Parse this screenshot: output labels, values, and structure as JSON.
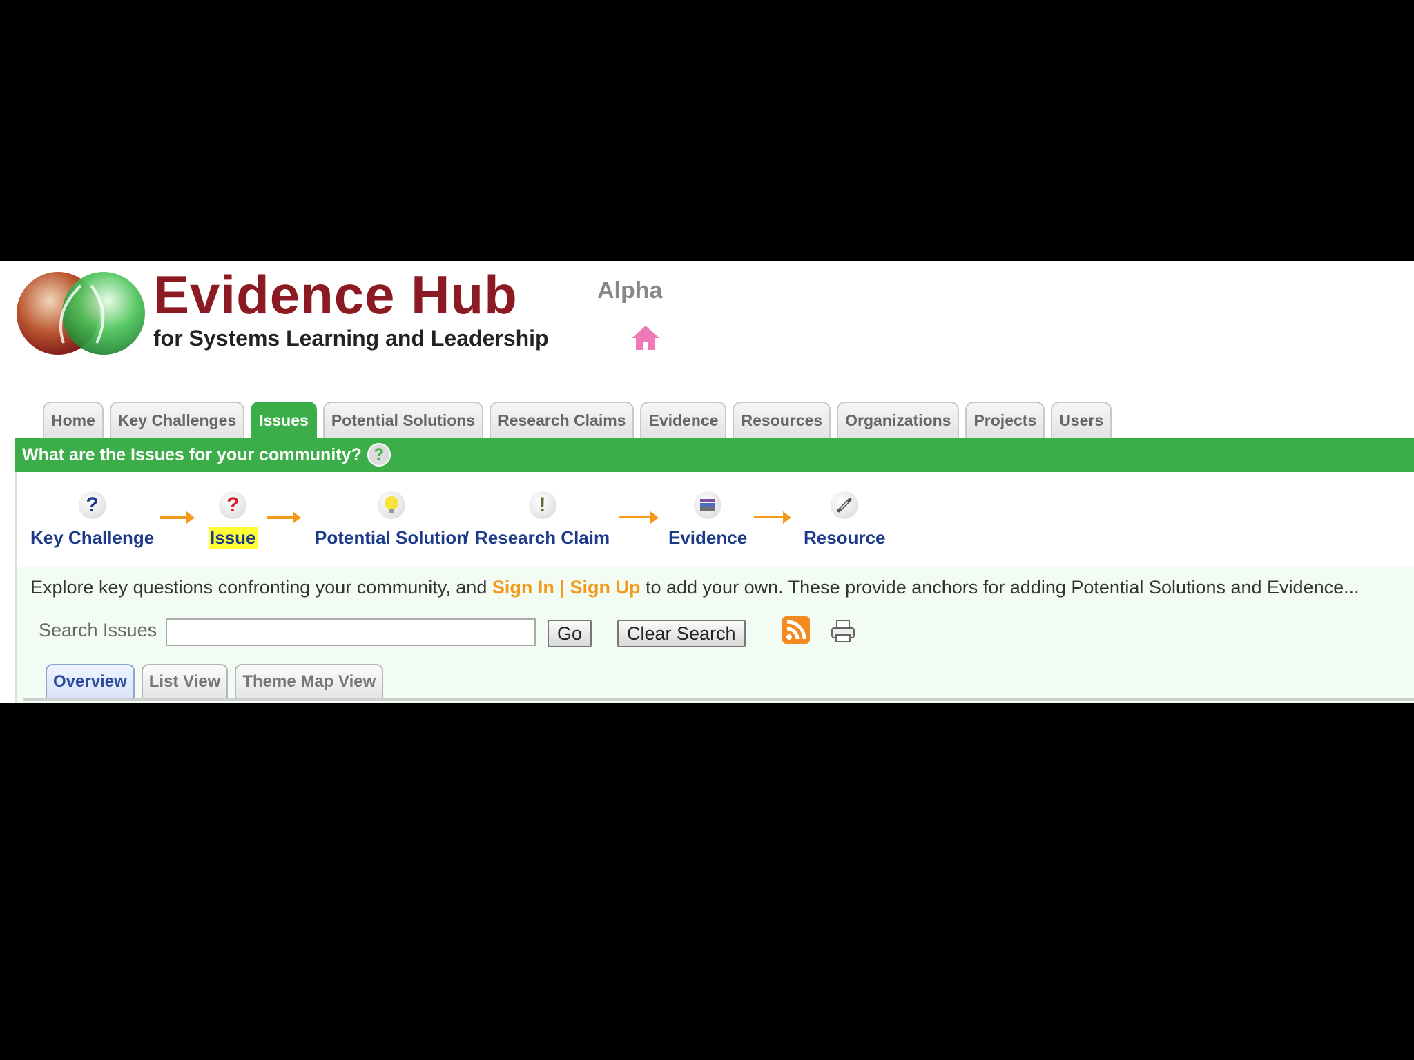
{
  "header": {
    "brand_title": "Evidence Hub",
    "brand_subtitle": "for Systems Learning and Leadership",
    "alpha_label": "Alpha",
    "home_icon": "home-icon"
  },
  "nav_tabs": [
    {
      "label": "Home",
      "active": false
    },
    {
      "label": "Key Challenges",
      "active": false
    },
    {
      "label": "Issues",
      "active": true
    },
    {
      "label": "Potential Solutions",
      "active": false
    },
    {
      "label": "Research Claims",
      "active": false
    },
    {
      "label": "Evidence",
      "active": false
    },
    {
      "label": "Resources",
      "active": false
    },
    {
      "label": "Organizations",
      "active": false
    },
    {
      "label": "Projects",
      "active": false
    },
    {
      "label": "Users",
      "active": false
    }
  ],
  "question_bar": {
    "text": "What are the Issues for your community?",
    "help_symbol": "?"
  },
  "flow": {
    "key_challenge": {
      "label": "Key Challenge",
      "icon_symbol": "?"
    },
    "issue": {
      "label": "Issue",
      "icon_symbol": "?"
    },
    "potential_solution": {
      "label": "Potential Solution",
      "icon": "lightbulb-icon"
    },
    "separator": "/",
    "research_claim": {
      "label": "Research Claim",
      "icon_symbol": "!"
    },
    "evidence": {
      "label": "Evidence",
      "icon": "books-icon"
    },
    "resource": {
      "label": "Resource",
      "icon": "link-icon"
    }
  },
  "explore": {
    "prefix": "Explore key questions confronting your community, and",
    "sign_in": "Sign In",
    "divider": "|",
    "sign_up": "Sign Up",
    "suffix": "to add your own. These provide anchors for adding Potential Solutions and Evidence..."
  },
  "search": {
    "label": "Search Issues",
    "value": "",
    "go_label": "Go",
    "clear_label": "Clear Search"
  },
  "view_tabs": [
    {
      "label": "Overview",
      "active": true
    },
    {
      "label": "List View",
      "active": false
    },
    {
      "label": "Theme Map View",
      "active": false
    }
  ],
  "colors": {
    "brand_red": "#8c1a22",
    "nav_green": "#3bae49",
    "link_orange": "#f39a1b",
    "flow_blue": "#1c3a8a"
  }
}
